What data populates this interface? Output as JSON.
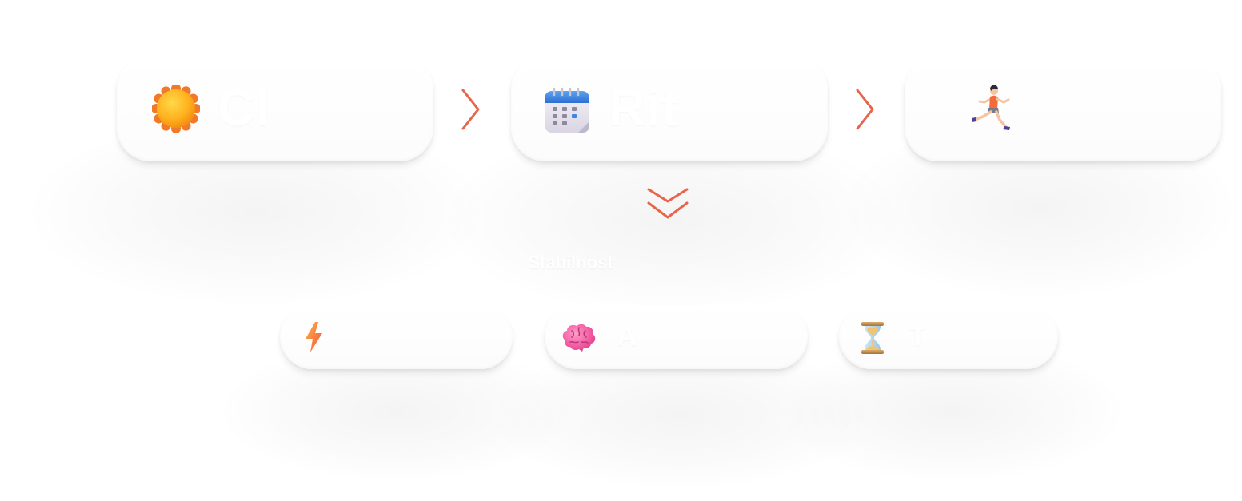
{
  "steps": [
    {
      "label": "Cl",
      "icon": "sun-icon"
    },
    {
      "label": "Rit",
      "icon": "calendar-icon"
    },
    {
      "label": "",
      "icon": "running-person-icon"
    }
  ],
  "caption": "Stabilnost",
  "results": [
    {
      "label": "",
      "icon": "lightning-icon"
    },
    {
      "label": "A",
      "icon": "brain-icon"
    },
    {
      "label": "T",
      "icon": "hourglass-icon"
    }
  ],
  "colors": {
    "accent": "#E8644A",
    "card": "#FFFFFF",
    "background": "#FFFFFF"
  }
}
